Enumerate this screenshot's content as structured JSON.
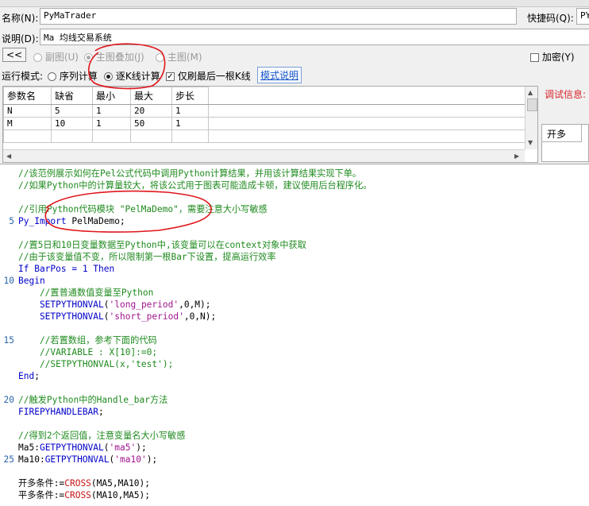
{
  "form": {
    "name_label": "名称(N):",
    "name_value": "PyMaTrader",
    "shortcut_label": "快捷码(Q):",
    "shortcut_value": "PY",
    "desc_label": "说明(D):",
    "desc_value": "Ma 均线交易系统"
  },
  "toolbar": {
    "back_label": "<<",
    "opt_subchart": "副图(U)",
    "opt_overlay": "主图叠加(J)",
    "opt_main": "主图(M)",
    "encrypt_label": "加密(Y)"
  },
  "mode": {
    "label": "运行模式:",
    "opt_sequence": "序列计算",
    "opt_kline": "逐K线计算",
    "refresh_last": "仅刷最后一根K线",
    "help_link": "模式说明"
  },
  "params": {
    "headers": [
      "参数名",
      "缺省",
      "最小",
      "最大",
      "步长"
    ],
    "rows": [
      [
        "N",
        "5",
        "1",
        "20",
        "1"
      ],
      [
        "M",
        "10",
        "1",
        "50",
        "1"
      ]
    ]
  },
  "side": {
    "debug_label": "调试信息:",
    "tab_open": "开多"
  },
  "editor": {
    "lines": [
      {
        "n": "",
        "segs": [
          {
            "c": "cm",
            "t": "//该范例展示如何在Pel公式代码中调用Python计算结果，并用该计算结果实现下单。"
          }
        ]
      },
      {
        "n": "",
        "segs": [
          {
            "c": "cm",
            "t": "//如果Python中的计算量较大，将该公式用于图表可能造成卡顿，建议使用后台程序化。"
          }
        ]
      },
      {
        "n": "",
        "segs": []
      },
      {
        "n": "",
        "segs": [
          {
            "c": "cm",
            "t": "//引用Python代码模块 \"PelMaDemo\"，需要注意大小写敏感"
          }
        ]
      },
      {
        "n": "5",
        "segs": [
          {
            "c": "kw",
            "t": "Py_Import"
          },
          {
            "c": "pl",
            "t": " PelMaDemo;"
          }
        ]
      },
      {
        "n": "",
        "segs": []
      },
      {
        "n": "",
        "segs": [
          {
            "c": "cm",
            "t": "//置5日和10日变量数据至Python中,该变量可以在context对象中获取"
          }
        ]
      },
      {
        "n": "",
        "segs": [
          {
            "c": "cm",
            "t": "//由于该变量值不变，所以限制第一根Bar下设置，提高运行效率"
          }
        ]
      },
      {
        "n": "",
        "segs": [
          {
            "c": "kw",
            "t": "If BarPos = 1 Then"
          }
        ]
      },
      {
        "n": "10",
        "segs": [
          {
            "c": "kw",
            "t": "Begin"
          }
        ]
      },
      {
        "n": "",
        "segs": [
          {
            "c": "cm",
            "t": "    //置普通数值变量至Python"
          }
        ]
      },
      {
        "n": "",
        "segs": [
          {
            "c": "kw",
            "t": "    SETPYTHONVAL"
          },
          {
            "c": "pl",
            "t": "("
          },
          {
            "c": "st",
            "t": "'long_period'"
          },
          {
            "c": "pl",
            "t": ",0,M);"
          }
        ]
      },
      {
        "n": "",
        "segs": [
          {
            "c": "kw",
            "t": "    SETPYTHONVAL"
          },
          {
            "c": "pl",
            "t": "("
          },
          {
            "c": "st",
            "t": "'short_period'"
          },
          {
            "c": "pl",
            "t": ",0,N);"
          }
        ]
      },
      {
        "n": "",
        "segs": []
      },
      {
        "n": "15",
        "segs": [
          {
            "c": "cm",
            "t": "    //若置数组，参考下面的代码"
          }
        ]
      },
      {
        "n": "",
        "segs": [
          {
            "c": "cm",
            "t": "    //VARIABLE : X[10]:=0;"
          }
        ]
      },
      {
        "n": "",
        "segs": [
          {
            "c": "cm",
            "t": "    //SETPYTHONVAL(x,'test');"
          }
        ]
      },
      {
        "n": "",
        "segs": [
          {
            "c": "kw",
            "t": "End"
          },
          {
            "c": "pl",
            "t": ";"
          }
        ]
      },
      {
        "n": "",
        "segs": []
      },
      {
        "n": "20",
        "segs": [
          {
            "c": "cm",
            "t": "//触发Python中的Handle_bar方法"
          }
        ]
      },
      {
        "n": "",
        "segs": [
          {
            "c": "kw",
            "t": "FIREPYHANDLEBAR"
          },
          {
            "c": "pl",
            "t": ";"
          }
        ]
      },
      {
        "n": "",
        "segs": []
      },
      {
        "n": "",
        "segs": [
          {
            "c": "cm",
            "t": "//得到2个返回值，注意变量名大小写敏感"
          }
        ]
      },
      {
        "n": "",
        "segs": [
          {
            "c": "pl",
            "t": "Ma5:"
          },
          {
            "c": "kw",
            "t": "GETPYTHONVAL"
          },
          {
            "c": "pl",
            "t": "("
          },
          {
            "c": "st",
            "t": "'ma5'"
          },
          {
            "c": "pl",
            "t": ");"
          }
        ]
      },
      {
        "n": "25",
        "segs": [
          {
            "c": "pl",
            "t": "Ma10:"
          },
          {
            "c": "kw",
            "t": "GETPYTHONVAL"
          },
          {
            "c": "pl",
            "t": "("
          },
          {
            "c": "st",
            "t": "'ma10'"
          },
          {
            "c": "pl",
            "t": ");"
          }
        ]
      },
      {
        "n": "",
        "segs": []
      },
      {
        "n": "",
        "segs": [
          {
            "c": "pl",
            "t": "开多条件:="
          },
          {
            "c": "fn",
            "t": "CROSS"
          },
          {
            "c": "pl",
            "t": "(MA5,MA10);"
          }
        ]
      },
      {
        "n": "",
        "segs": [
          {
            "c": "pl",
            "t": "平多条件:="
          },
          {
            "c": "fn",
            "t": "CROSS"
          },
          {
            "c": "pl",
            "t": "(MA10,MA5);"
          }
        ]
      }
    ]
  },
  "colors": {
    "annotation": "#e0161b",
    "link": "#1a56c8",
    "debug_label": "#d9262b"
  }
}
